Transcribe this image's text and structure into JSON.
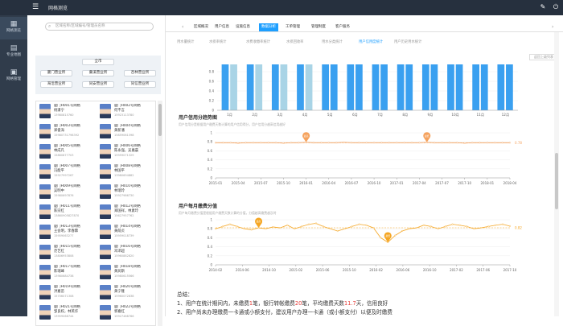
{
  "topbar": {
    "title": "网格测览",
    "menu_icon": "menu-icon",
    "icons": [
      "pin-icon",
      "power-icon"
    ]
  },
  "leftnav": [
    {
      "label": "网格测览",
      "icon": "grid-icon"
    },
    {
      "label": "专业地图",
      "icon": "map-icon"
    },
    {
      "label": "网格管理",
      "icon": "manage-icon"
    }
  ],
  "search": {
    "placeholder": "区域名称/区域编号/管理员名称"
  },
  "tree": {
    "root": "全市",
    "buttons": [
      "厦门营业所",
      "藁溪营业所",
      "杏林营业所",
      "海沧营业所",
      "同安营业所",
      "同信营业所"
    ]
  },
  "persons": [
    {
      "line1": "厦门H001号网格",
      "line2": "杨潇宁",
      "phone": "13980815760"
    },
    {
      "line1": "厦门H002号网格",
      "line2": "何不言",
      "phone": "15923113780"
    },
    {
      "line1": "厦门H003号网格",
      "line2": "郑俊海",
      "phone": "15980731798392"
    },
    {
      "line1": "厦门H004号网格",
      "line2": "黄新潘",
      "phone": "15859061398"
    },
    {
      "line1": "厦门H005号网格",
      "line2": "林成凡",
      "phone": "15860877703"
    },
    {
      "line1": "厦门H006号网格",
      "line2": "陈永强，吴嘉晨",
      "phone": "15959071329"
    },
    {
      "line1": "厦门H007号网格",
      "line2": "冯能平",
      "phone": "15927997267"
    },
    {
      "line1": "厦门H008号网格",
      "line2": "林国平",
      "phone": "13980694882"
    },
    {
      "line1": "厦门H009号网格",
      "line2": "吴明中",
      "phone": "15980697876"
    },
    {
      "line1": "厦门H010号网格",
      "line2": "林瑞玲",
      "phone": "15927986730"
    },
    {
      "line1": "厦门H011号网格",
      "line2": "陈宗红",
      "phone": "13860905827870"
    },
    {
      "line1": "厦门H012号网格",
      "line2": "郑国祥，林素玲",
      "phone": "15627957762"
    },
    {
      "line1": "厦门H013号网格",
      "line2": "王会明，李春霖",
      "phone": "15959063277"
    },
    {
      "line1": "厦门H014号网格",
      "line2": "黄荫贞",
      "phone": "15959018739"
    },
    {
      "line1": "厦门H015号网格",
      "line2": "范艺红",
      "phone": "13806953808"
    },
    {
      "line1": "厦门H016号网格",
      "line2": "邓泽超",
      "phone": "15960882820"
    },
    {
      "line1": "厦门H017号网格",
      "line2": "陈瑞峰",
      "phone": "13980684738"
    },
    {
      "line1": "厦门H018号网格",
      "line2": "黄润斯",
      "phone": "15980615566"
    },
    {
      "line1": "厦门H019号网格",
      "line2": "洪嘉苗",
      "phone": "15706071308"
    },
    {
      "line1": "厦门H020号网格",
      "line2": "黄宁隆",
      "phone": "15960072838"
    },
    {
      "line1": "厦门H021号网格",
      "line2": "邹良权，林英华",
      "phone": "13959068744"
    },
    {
      "line1": "厦门H022号网格",
      "line2": "郭嘉红",
      "phone": "15927468766"
    }
  ],
  "tabs": [
    "区域概况",
    "用户信息",
    "设施信息",
    "数据分析",
    "工单管理",
    "管理制度",
    "客户服务"
  ],
  "active_tab": "数据分析",
  "subtabs": [
    "用水量统计",
    "水损率统计",
    "水费收缴率统计",
    "水损回收率",
    "用水分类统计",
    "用户信用度统计",
    "用户历史用水统计"
  ],
  "active_subtab": "用户信用度统计",
  "back_button": "返回上级列表",
  "summary": {
    "heading": "总结：",
    "line1_prefix": "1、用户在统计期间内，未缴费",
    "line1_n1": "1",
    "line1_mid1": "笔，银行转帐缴费",
    "line1_n2": "20",
    "line1_mid2": "笔，平均缴费天数",
    "line1_n3": "11.7",
    "line1_suffix": "天，信用良好",
    "line2": "2、用户尚未办理缴费一卡通或小额支付，建议用户办理一卡通（或小额支付）以便及时缴费"
  },
  "chart_data": [
    {
      "type": "bar",
      "title": "",
      "categories": [
        "1月",
        "2月",
        "3月",
        "4月",
        "5月",
        "6月",
        "7月",
        "8月",
        "9月",
        "10月",
        "11月",
        "12月"
      ],
      "values": [
        0.95,
        0.95,
        0.95,
        0.95,
        0.95,
        0.95,
        0.95,
        0.95,
        0.95,
        0.95,
        0.95,
        0.95
      ],
      "bars_per_category": 2,
      "highlighted": [
        0,
        1,
        2,
        3
      ],
      "ylim": [
        0,
        1
      ],
      "yticks": [
        "0",
        "0.2",
        "0.4",
        "0.6",
        "0.8"
      ],
      "colors": {
        "normal": "#3aa0f0",
        "light": "#a9d4e6"
      }
    },
    {
      "type": "line",
      "title": "用户信用分趋势图",
      "subtitle": "用户信用分是根据用户缴费天数计算的用户信用得分，用户信用分越高信用越好",
      "xticks": [
        "2015-01",
        "2015-04",
        "2015-07",
        "2015-10",
        "2016-01",
        "2016-04",
        "2016-07",
        "2016-10",
        "2017-01",
        "2017-04",
        "2017-07",
        "2017-10",
        "2018-01",
        "2018-04"
      ],
      "values": [
        0.78,
        0.78,
        0.78,
        0.77,
        0.78,
        0.78,
        0.78,
        0.78,
        0.78,
        0.77,
        0.78,
        0.78,
        0.79,
        0.78,
        0.78,
        0.78,
        0.78,
        0.79,
        0.78,
        0.78,
        0.78,
        0.78,
        0.78,
        0.78,
        0.78,
        0.78,
        0.78,
        0.78,
        0.79,
        0.78,
        0.78,
        0.78,
        0.78,
        0.77,
        0.78,
        0.78,
        0.78,
        0.78,
        0.78,
        0.78
      ],
      "markpoints": [
        {
          "index": 12,
          "label": "最高"
        },
        {
          "index": 28,
          "label": "最低"
        }
      ],
      "avg_label": "0.78",
      "ylim": [
        0,
        1
      ],
      "yticks": [
        "0",
        "0.2",
        "0.4",
        "0.6",
        "0.8",
        "1"
      ],
      "color": "#f5a25d"
    },
    {
      "type": "line",
      "title": "用户每月缴费分值",
      "subtitle": "用户每月缴费分值是根据用户缴费天数计算的分值，分值越高缴费越及时",
      "xticks": [
        "2014-02",
        "2014-06",
        "2014-10",
        "2015-02",
        "2015-06",
        "2015-10",
        "2016-02",
        "2016-06",
        "2016-10",
        "2017-02",
        "2017-06",
        "2017-10"
      ],
      "values": [
        0.8,
        0.85,
        0.9,
        0.85,
        0.8,
        0.78,
        0.82,
        0.8,
        0.84,
        0.82,
        0.88,
        0.8,
        0.85,
        0.9,
        0.92,
        0.85,
        0.8,
        0.75,
        0.8,
        0.85,
        0.9,
        0.88,
        0.82,
        0.6,
        0.5,
        0.65,
        0.75,
        0.8,
        0.82,
        0.88,
        0.85,
        0.8,
        0.85,
        0.9,
        0.88,
        0.85,
        0.8,
        0.82,
        0.85,
        0.88,
        0.9,
        0.86
      ],
      "markpoints": [
        {
          "index": 6,
          "label": "最高"
        },
        {
          "index": 24,
          "label": "最低"
        }
      ],
      "avg_label": "0.82",
      "ylim": [
        0,
        1
      ],
      "yticks": [
        "0",
        "0.2",
        "0.4",
        "0.6",
        "0.8",
        "1"
      ],
      "color": "#f5a623"
    }
  ]
}
